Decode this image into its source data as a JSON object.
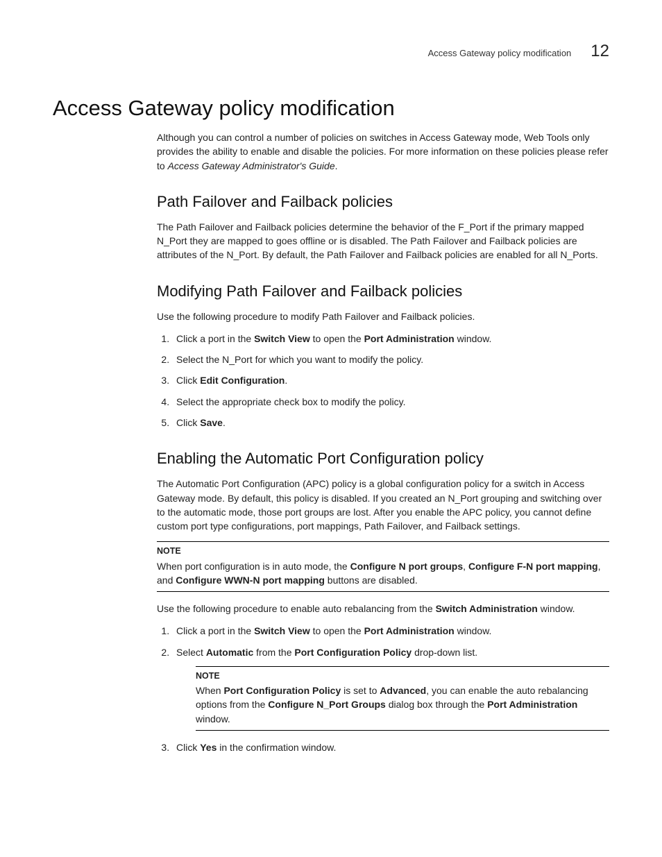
{
  "header": {
    "running_title": "Access Gateway policy modification",
    "chapter_number": "12"
  },
  "h1": "Access Gateway policy modification",
  "intro": {
    "text_before_italic": "Although you can control a number of policies on switches in Access Gateway mode, Web Tools only provides the ability to enable and disable the policies. For more information on these policies please refer to ",
    "italic": "Access Gateway Administrator's Guide",
    "text_after_italic": "."
  },
  "sec1": {
    "title": "Path Failover and Failback policies",
    "para": "The Path Failover and Failback policies determine the behavior of the F_Port if the primary mapped N_Port they are mapped to goes offline or is disabled. The Path Failover and Failback policies are attributes of the N_Port. By default, the Path Failover and Failback policies are enabled for all N_Ports."
  },
  "sec2": {
    "title": "Modifying Path Failover and Failback policies",
    "intro": "Use the following procedure to modify Path Failover and Failback policies.",
    "li1_a": "Click a port in the ",
    "li1_b": "Switch View",
    "li1_c": " to open the ",
    "li1_d": "Port Administration",
    "li1_e": " window.",
    "li2": "Select the N_Port for which you want to modify the policy.",
    "li3_a": "Click ",
    "li3_b": "Edit Configuration",
    "li3_c": ".",
    "li4": "Select the appropriate check box to modify the policy.",
    "li5_a": "Click ",
    "li5_b": "Save",
    "li5_c": "."
  },
  "sec3": {
    "title": "Enabling the Automatic Port Configuration policy",
    "para": "The Automatic Port Configuration (APC) policy is a global configuration policy for a switch in Access Gateway mode. By default, this policy is disabled. If you created an N_Port grouping and switching over to the automatic mode, those port groups are lost. After you enable the APC policy, you cannot define custom port type configurations, port mappings, Path Failover, and Failback settings.",
    "note1_label": "NOTE",
    "note1_a": "When port configuration is in auto mode, the ",
    "note1_b": "Configure N port groups",
    "note1_c": ", ",
    "note1_d": "Configure F-N port mapping",
    "note1_e": ", and ",
    "note1_f": "Configure WWN-N port mapping",
    "note1_g": " buttons are disabled.",
    "p2_a": "Use the following procedure to enable auto rebalancing from the ",
    "p2_b": "Switch Administration",
    "p2_c": " window.",
    "li1_a": "Click a port in the ",
    "li1_b": "Switch View",
    "li1_c": " to open the ",
    "li1_d": "Port Administration",
    "li1_e": " window.",
    "li2_a": "Select ",
    "li2_b": "Automatic",
    "li2_c": " from the ",
    "li2_d": "Port Configuration Policy",
    "li2_e": " drop-down list.",
    "note2_label": "NOTE",
    "note2_a": "When ",
    "note2_b": "Port Configuration Policy",
    "note2_c": " is set to ",
    "note2_d": "Advanced",
    "note2_e": ", you can enable the auto rebalancing options from the ",
    "note2_f": "Configure N_Port Groups",
    "note2_g": " dialog box through the ",
    "note2_h": "Port Administration",
    "note2_i": " window.",
    "li3_a": "Click ",
    "li3_b": "Yes",
    "li3_c": " in the confirmation window."
  }
}
